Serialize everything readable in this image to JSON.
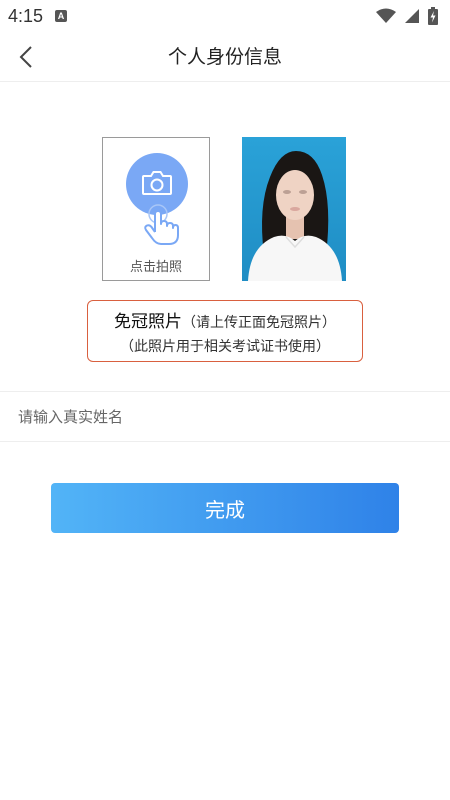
{
  "status_bar": {
    "time": "4:15",
    "notification_icon": "A",
    "icons": [
      "wifi-icon",
      "signal-icon",
      "battery-charging-icon"
    ]
  },
  "header": {
    "back_icon": "chevron-left-icon",
    "title": "个人身份信息"
  },
  "photo_upload": {
    "icon": "camera-icon",
    "hand_icon": "tap-hand-icon",
    "label": "点击拍照",
    "accent_color": "#7aa8f5"
  },
  "sample_photo": {
    "background_color": "#2aa2d8"
  },
  "photo_note": {
    "title": "免冠照片",
    "subtitle": "（请上传正面免冠照片）",
    "detail": "（此照片用于相关考试证书使用）",
    "border_color": "#d9603f"
  },
  "name_field": {
    "placeholder": "请输入真实姓名",
    "value": ""
  },
  "submit": {
    "label": "完成",
    "gradient": [
      "#52b4f7",
      "#2f82e8"
    ]
  }
}
